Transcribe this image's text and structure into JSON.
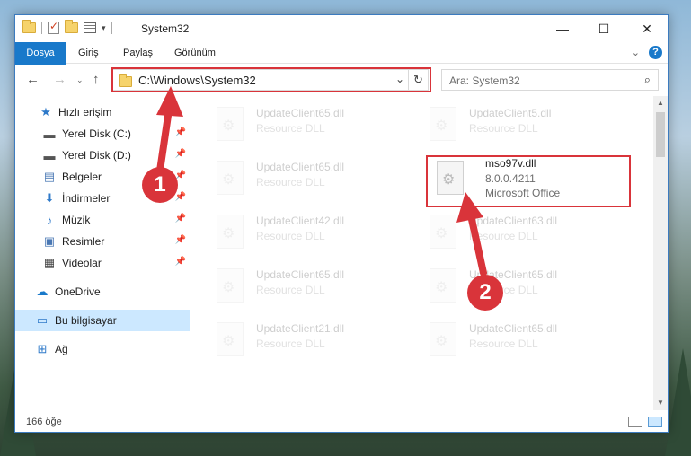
{
  "window": {
    "title": "System32",
    "controls": {
      "minimize": "—",
      "maximize": "☐",
      "close": "✕"
    }
  },
  "ribbon": {
    "tabs": [
      "Dosya",
      "Giriş",
      "Paylaş",
      "Görünüm"
    ]
  },
  "address": {
    "path": "C:\\Windows\\System32",
    "search_placeholder": "Ara: System32"
  },
  "sidebar": {
    "items": [
      {
        "label": "Hızlı erişim",
        "icon": "star-icon",
        "pinned": false
      },
      {
        "label": "Yerel Disk (C:)",
        "icon": "drive-icon",
        "pinned": true
      },
      {
        "label": "Yerel Disk (D:)",
        "icon": "drive-icon",
        "pinned": true
      },
      {
        "label": "Belgeler",
        "icon": "documents-icon",
        "pinned": true
      },
      {
        "label": "İndirmeler",
        "icon": "downloads-icon",
        "pinned": true
      },
      {
        "label": "Müzik",
        "icon": "music-icon",
        "pinned": true
      },
      {
        "label": "Resimler",
        "icon": "pictures-icon",
        "pinned": true
      },
      {
        "label": "Videolar",
        "icon": "videos-icon",
        "pinned": true
      },
      {
        "label": "OneDrive",
        "icon": "cloud-icon",
        "pinned": false
      },
      {
        "label": "Bu bilgisayar",
        "icon": "computer-icon",
        "pinned": false,
        "selected": true
      },
      {
        "label": "Ağ",
        "icon": "network-icon",
        "pinned": false
      }
    ]
  },
  "files": {
    "left": [
      {
        "name": "UpdateClient65.dll",
        "type": "Resource DLL"
      },
      {
        "name": "UpdateClient65.dll",
        "type": "Resource DLL"
      },
      {
        "name": "UpdateClient42.dll",
        "type": "Resource DLL"
      },
      {
        "name": "UpdateClient65.dll",
        "type": "Resource DLL"
      },
      {
        "name": "UpdateClient21.dll",
        "type": "Resource DLL"
      }
    ],
    "right": [
      {
        "name": "UpdateClient5.dll",
        "type": "Resource DLL"
      },
      {
        "name": "mso97v.dll",
        "version": "8.0.0.4211",
        "type": "Microsoft Office",
        "highlighted": true
      },
      {
        "name": "UpdateClient63.dll",
        "type": "Resource DLL"
      },
      {
        "name": "UpdateClient65.dll",
        "type": "Resource DLL"
      },
      {
        "name": "UpdateClient65.dll",
        "type": "Resource DLL"
      }
    ]
  },
  "status": {
    "item_count": "166 öğe"
  },
  "annotations": {
    "step1": "1",
    "step2": "2",
    "color": "#d9343a"
  }
}
